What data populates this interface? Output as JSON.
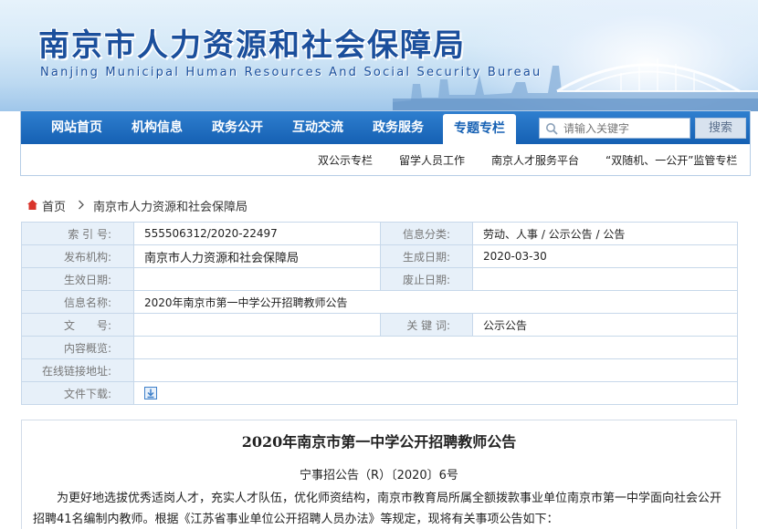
{
  "header": {
    "title": "南京市人力资源和社会保障局",
    "subtitle": "Nanjing Municipal Human Resources And Social Security Bureau"
  },
  "nav": {
    "items": [
      {
        "label": "网站首页"
      },
      {
        "label": "机构信息"
      },
      {
        "label": "政务公开"
      },
      {
        "label": "互动交流"
      },
      {
        "label": "政务服务"
      },
      {
        "label": "专题专栏",
        "active": true
      }
    ],
    "search": {
      "placeholder": "请输入关键字",
      "button_label": "搜索"
    },
    "subnav": [
      {
        "label": "双公示专栏"
      },
      {
        "label": "留学人员工作"
      },
      {
        "label": "南京人才服务平台"
      },
      {
        "label": "“双随机、一公开”监管专栏"
      }
    ]
  },
  "breadcrumb": {
    "home": "首页",
    "current": "南京市人力资源和社会保障局"
  },
  "info": {
    "index_label": "索 引 号:",
    "index_value": "555506312/2020-22497",
    "category_label": "信息分类:",
    "category_value": "劳动、人事 / 公示公告 / 公告",
    "publisher_label": "发布机构:",
    "publisher_value": "南京市人力资源和社会保障局",
    "created_label": "生成日期:",
    "created_value": "2020-03-30",
    "effective_label": "生效日期:",
    "effective_value": "",
    "expiry_label": "废止日期:",
    "expiry_value": "",
    "name_label": "信息名称:",
    "name_value": "2020年南京市第一中学公开招聘教师公告",
    "docno_label": "文　　号:",
    "docno_value": "",
    "keywords_label": "关 键 词:",
    "keywords_value": "公示公告",
    "summary_label": "内容概览:",
    "summary_value": "",
    "link_label": "在线链接地址:",
    "link_value": "",
    "download_label": "文件下载:"
  },
  "article": {
    "title": "2020年南京市第一中学公开招聘教师公告",
    "doc_number": "宁事招公告（R）〔2020〕6号",
    "body": "为更好地选拔优秀适岗人才，充实人才队伍，优化师资结构，南京市教育局所属全额拨款事业单位南京市第一中学面向社会公开招聘41名编制内教师。根据《江苏省事业单位公开招聘人员办法》等规定，现将有关事项公告如下："
  },
  "colors": {
    "nav_blue": "#1560b3",
    "title_blue": "#1b4f9c",
    "label_bg": "#e7f0f9",
    "border": "#c7d8ea"
  }
}
